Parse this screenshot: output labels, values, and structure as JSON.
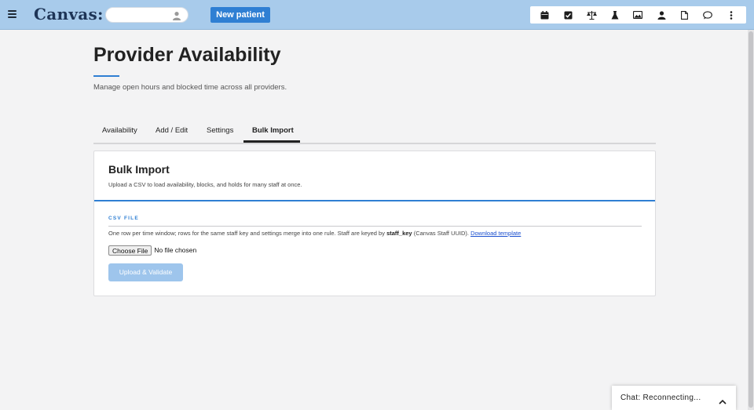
{
  "app": {
    "logo": "Canvas:"
  },
  "topbar": {
    "menu_icon": "hamburger-icon",
    "search_icon": "person-icon",
    "new_patient_label": "New patient",
    "toolbar_icons": [
      "calendar-icon",
      "checkbox-icon",
      "scales-icon",
      "flask-icon",
      "image-icon",
      "user-icon",
      "document-icon",
      "chat-bubble-icon",
      "more-vertical-icon"
    ]
  },
  "page": {
    "title": "Provider Availability",
    "subtitle": "Manage open hours and blocked time across all providers."
  },
  "tabs": [
    {
      "label": "Availability",
      "active": false
    },
    {
      "label": "Add / Edit",
      "active": false
    },
    {
      "label": "Settings",
      "active": false
    },
    {
      "label": "Bulk Import",
      "active": true
    }
  ],
  "card": {
    "title": "Bulk Import",
    "subtitle": "Upload a CSV to load availability, blocks, and holds for many staff at once.",
    "section_label": "CSV FILE",
    "help_prefix": "One row per time window; rows for the same staff key and settings merge into one rule. Staff are keyed by ",
    "help_key": "staff_key",
    "help_suffix": " (Canvas Staff UUID). ",
    "help_link": "Download template",
    "choose_file_label": "Choose File",
    "file_status": "No file chosen",
    "upload_label": "Upload & Validate"
  },
  "chat": {
    "label": "Chat: Reconnecting...",
    "icon": "chevron-up-icon"
  },
  "colors": {
    "topbar": "#a8cbeb",
    "accent": "#2f7fd3",
    "disabled_button": "#9ec5ec",
    "link": "#1a4fcf"
  }
}
